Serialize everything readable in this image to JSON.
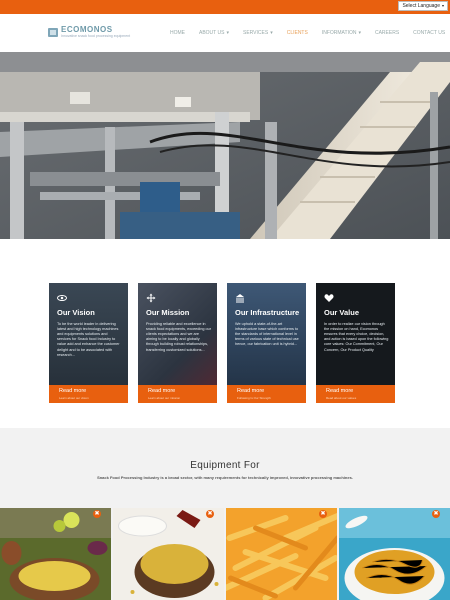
{
  "topbar": {
    "language_label": "Select Language",
    "caret": "▾"
  },
  "header": {
    "logo_text": "ECOMONOS",
    "logo_tagline": "Innovative snack food processing equipment",
    "nav": [
      {
        "label": "HOME",
        "has_caret": false,
        "active": false
      },
      {
        "label": "ABOUT US",
        "has_caret": true,
        "active": false
      },
      {
        "label": "SERVICES",
        "has_caret": true,
        "active": false
      },
      {
        "label": "CLIENTS",
        "has_caret": false,
        "active": true
      },
      {
        "label": "INFORMATION",
        "has_caret": true,
        "active": false
      },
      {
        "label": "CAREERS",
        "has_caret": false,
        "active": false
      },
      {
        "label": "CONTACT US",
        "has_caret": false,
        "active": false
      }
    ]
  },
  "cards": [
    {
      "icon": "eye-icon",
      "title": "Our Vision",
      "body": "To be the world leader in delivering latest and high technology machines and equipments solutions and services for Snack food Industry to value add and enhance the customer delight and to be associated with research...",
      "read_more": "Read more",
      "sub": "Learn about our vision",
      "color": "#2d3a46"
    },
    {
      "icon": "arrows-icon",
      "title": "Our Mission",
      "body": "Providing reliable and excellence in snack food equipments, exceeding our clients expectations and we are aiming to be locally and globally through building robust relationships, transferring customized solutions...",
      "read_more": "Read more",
      "sub": "Learn about our mission",
      "color": "#3d4654"
    },
    {
      "icon": "building-icon",
      "title": "Our Infrastructure",
      "body": "We uphold a state-of-the-art infrastructure base which conforms to the standards of international level in terms of various state of technical use hence, our fabrication unit is hybrid...",
      "read_more": "Read more",
      "sub": "Following Is Our Strength",
      "color": "#2a3f5a"
    },
    {
      "icon": "heart-icon",
      "title": "Our Value",
      "body": "In order to realize our vision through the mission on hand, Ecomonos ensures that every choice, decision, and action is based upon the following core values: Our Commitment, Our Concern, Our Product Quality",
      "read_more": "Read more",
      "sub": "Read about our values",
      "color": "#14181c"
    }
  ],
  "equipment": {
    "heading": "Equipment For",
    "description": "Snack Food Processing Industry is a broad sector, with many requirements for technically improved, innovative processing machines.",
    "tile_close": "✖",
    "tiles": [
      {
        "name": "tile-dal"
      },
      {
        "name": "tile-chickpeas"
      },
      {
        "name": "tile-fries"
      },
      {
        "name": "tile-namkeen"
      }
    ]
  },
  "colors": {
    "accent": "#e8600f",
    "logo": "#6f9aa9"
  }
}
